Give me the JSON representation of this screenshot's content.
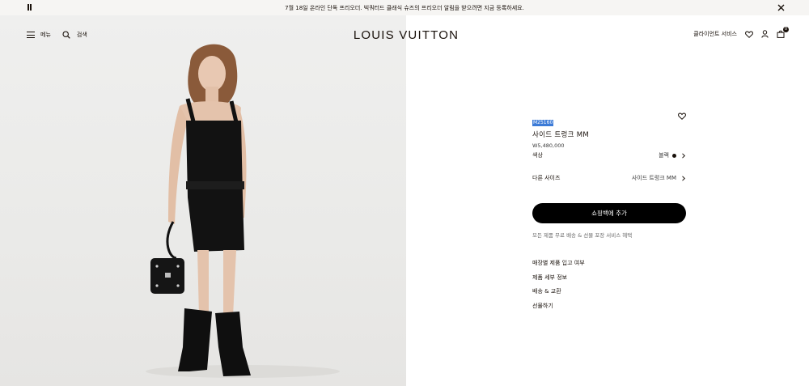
{
  "announcement": {
    "text": "7월 18일 온라인 단독 프리오더. 빅쿼터드 클래식 슈즈의 프리오더 알림을 받으려면 지금 등록하세요."
  },
  "header": {
    "menu_label": "메뉴",
    "search_label": "검색",
    "logo": "LOUIS VUITTON",
    "client_service_label": "클라이언트 서비스",
    "bag_count": "0"
  },
  "product": {
    "sku": "M25160",
    "name": "사이드 트렁크 MM",
    "price": "W5,480,000",
    "options": [
      {
        "label": "색상",
        "value": "블랙"
      },
      {
        "label": "다른 사이즈",
        "value": "사이드 트렁크 MM"
      }
    ],
    "add_to_bag": "쇼핑백에 추가",
    "shipping_note": "모든 제품 무료 배송 & 선물 포장 서비스 혜택",
    "links": [
      "매장별 제품 입고 여부",
      "제품 세부 정보",
      "배송 & 교환",
      "선물하기"
    ]
  },
  "colors": {
    "accent": "#19110b",
    "selection": "#3c7bd7",
    "cta_bg": "#000000"
  }
}
